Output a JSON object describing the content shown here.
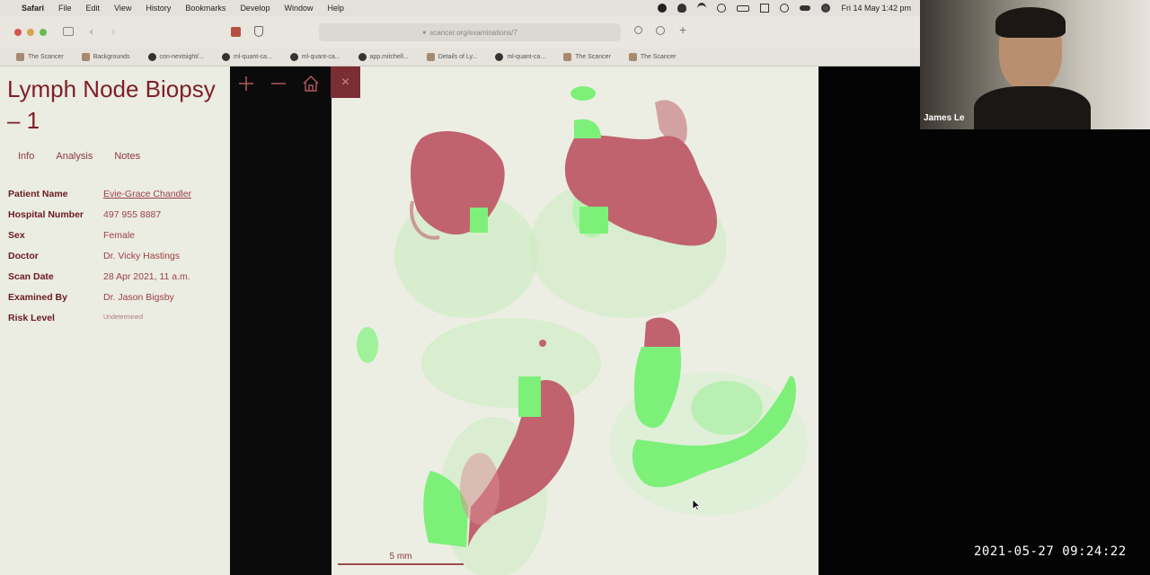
{
  "menubar": {
    "app": "Safari",
    "items": [
      "File",
      "Edit",
      "View",
      "History",
      "Bookmarks",
      "Develop",
      "Window",
      "Help"
    ],
    "clock": "Fri 14 May  1:42 pm"
  },
  "browser": {
    "url": "scancer.org/examinations/7",
    "bookmarks": [
      {
        "label": "The Scancer",
        "icon": "site-icon"
      },
      {
        "label": "Backgrounds",
        "icon": "site-icon"
      },
      {
        "label": "con-nextsight/...",
        "icon": "github-icon"
      },
      {
        "label": "ml-quant-ca...",
        "icon": "github-icon"
      },
      {
        "label": "ml-quant-ca...",
        "icon": "github-icon"
      },
      {
        "label": "app.mitchell...",
        "icon": "github-icon"
      },
      {
        "label": "Details of Ly...",
        "icon": "site-icon"
      },
      {
        "label": "ml-quant-ca...",
        "icon": "github-icon"
      },
      {
        "label": "The Scancer",
        "icon": "site-icon"
      },
      {
        "label": "The Scancer",
        "icon": "site-icon"
      }
    ]
  },
  "page": {
    "title": "Lymph Node Biopsy – 1",
    "tabs": [
      "Info",
      "Analysis",
      "Notes"
    ],
    "fields": [
      {
        "label": "Patient Name",
        "value": "Evie-Grace Chandler"
      },
      {
        "label": "Hospital Number",
        "value": "497 955 8887"
      },
      {
        "label": "Sex",
        "value": "Female"
      },
      {
        "label": "Doctor",
        "value": "Dr. Vicky Hastings"
      },
      {
        "label": "Scan Date",
        "value": "28 Apr 2021, 11 a.m."
      },
      {
        "label": "Examined By",
        "value": "Dr. Jason Bigsby"
      },
      {
        "label": "Risk Level",
        "value": "Undetermined"
      }
    ]
  },
  "viewer": {
    "scale_label": "5 mm",
    "colors": {
      "tumor": "#c0636f",
      "normal": "#7df07a",
      "tissue_faint": "#c9ecc0"
    }
  },
  "webcam": {
    "name": "James Le"
  },
  "recording_timestamp": "2021-05-27  09:24:22"
}
